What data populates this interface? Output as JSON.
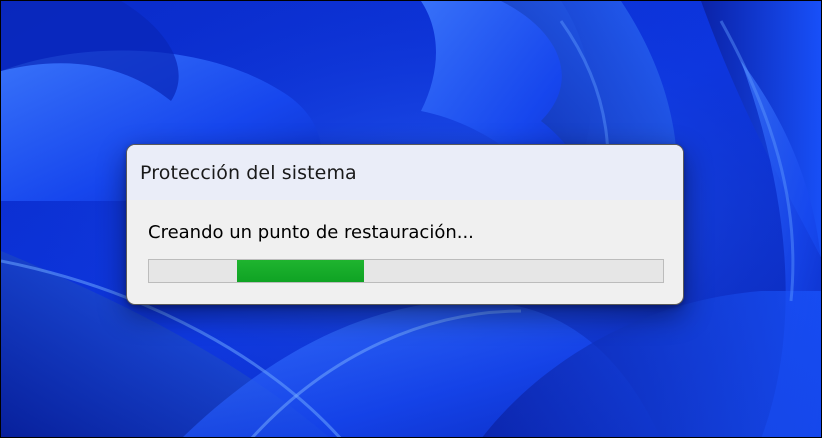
{
  "dialog": {
    "title": "Protección del sistema",
    "message": "Creando un punto de restauración...",
    "progress": {
      "mode": "indeterminate",
      "segment_start_fraction": 0.172,
      "segment_end_fraction": 0.418,
      "fill_color": "#06b025",
      "track_color": "#e6e6e6"
    }
  },
  "wallpaper": {
    "name": "windows-11-bloom",
    "base_color": "#0b2fd0"
  }
}
